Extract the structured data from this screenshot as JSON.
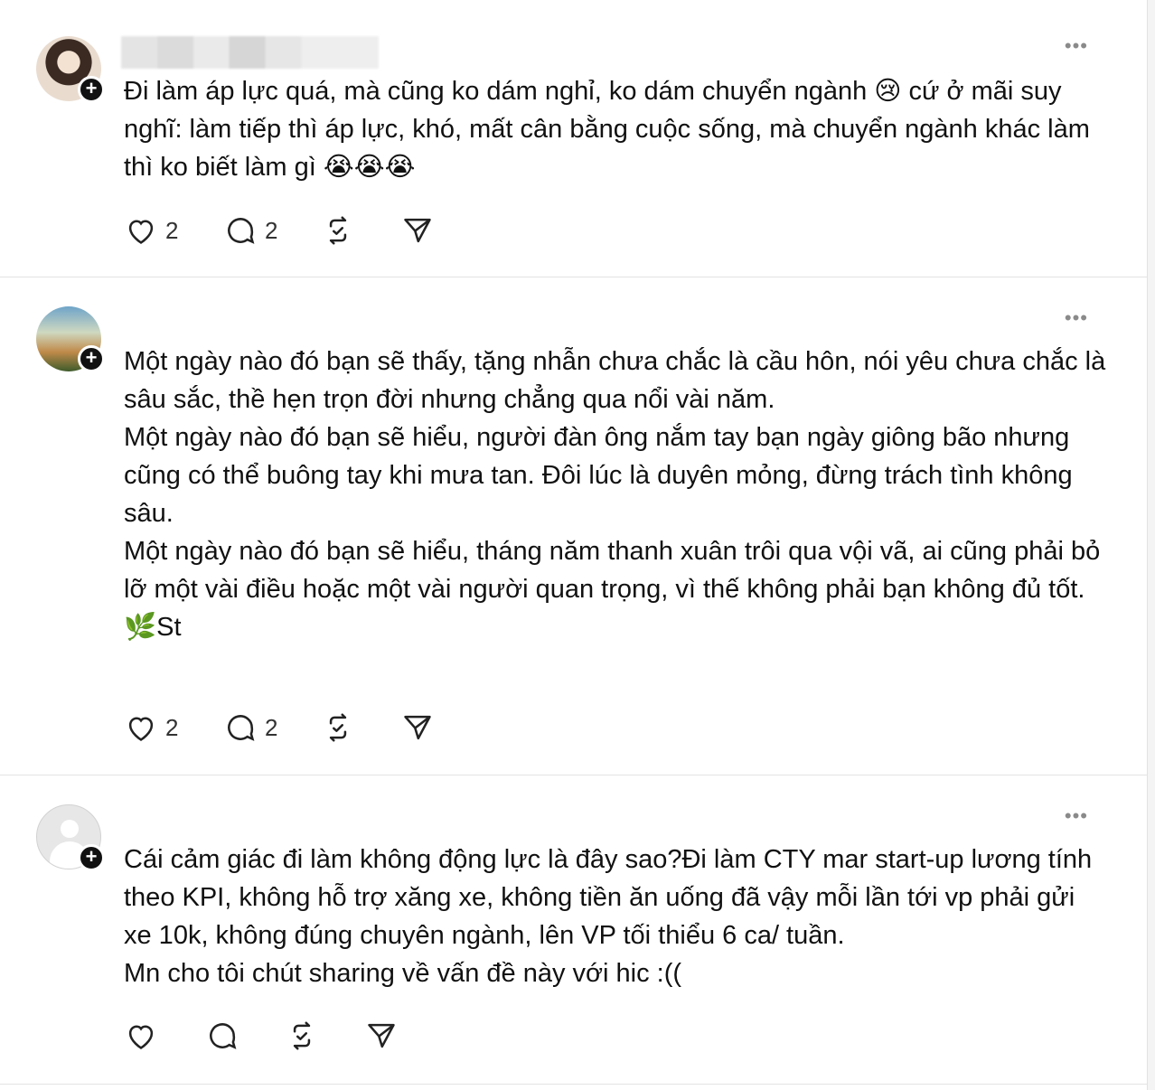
{
  "posts": [
    {
      "text": "Đi làm áp lực quá, mà cũng ko dám nghỉ, ko dám chuyển ngành 😢 cứ ở mãi suy nghĩ: làm tiếp thì áp lực, khó, mất cân bằng cuộc sống, mà chuyển ngành khác làm thì ko biết làm gì 😭😭😭",
      "likes": "2",
      "comments": "2"
    },
    {
      "text": "Một ngày nào đó bạn sẽ thấy, tặng nhẫn chưa chắc là cầu hôn, nói yêu chưa chắc là sâu sắc, thề hẹn trọn đời nhưng chẳng qua nổi vài năm.\nMột ngày nào đó bạn sẽ hiểu, người đàn ông nắm tay bạn ngày giông bão nhưng cũng có thể buông tay khi mưa tan. Đôi lúc là duyên mỏng, đừng trách tình không sâu.\nMột ngày nào đó bạn sẽ hiểu, tháng năm thanh xuân trôi qua vội vã, ai cũng phải bỏ lỡ một vài điều hoặc một vài người quan trọng, vì thế không phải bạn không đủ tốt.\n🌿St",
      "likes": "2",
      "comments": "2"
    },
    {
      "text": "Cái cảm giác đi làm không động lực là đây sao?Đi làm CTY mar start-up lương tính theo KPI, không hỗ trợ xăng xe, không tiền ăn uống đã vậy mỗi lần tới vp phải gửi xe 10k, không đúng chuyên ngành, lên VP tối thiểu 6 ca/ tuần.\nMn cho tôi chút sharing về vấn đề này với hic :((",
      "likes": "",
      "comments": ""
    }
  ],
  "icons": {
    "like": "heart-icon",
    "comment": "comment-bubble-icon",
    "repost": "repost-icon",
    "share": "send-icon",
    "more": "more-dots-icon",
    "follow": "plus-icon"
  },
  "more_label": "•••",
  "follow_label": "+"
}
